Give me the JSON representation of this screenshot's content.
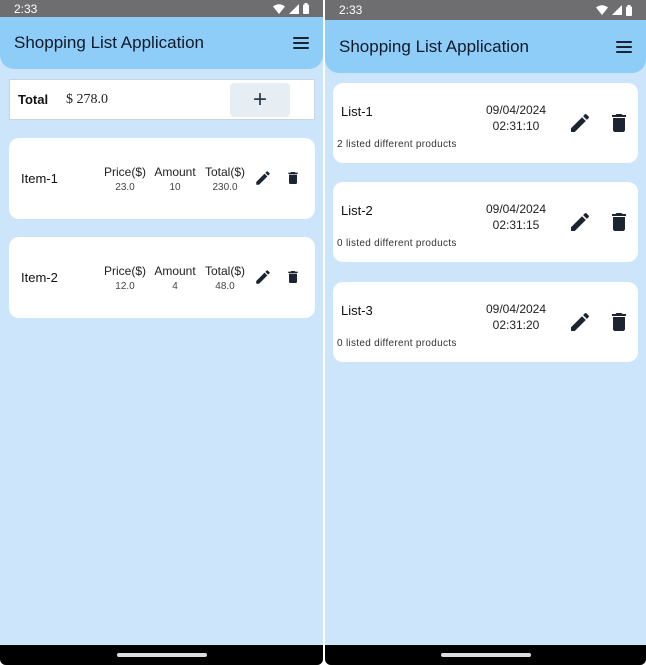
{
  "status_time": "2:33",
  "app_title": "Shopping List Application",
  "icons": {
    "menu": "menu-icon",
    "wifi": "wifi-icon",
    "signal": "signal-icon",
    "battery": "battery-icon",
    "edit": "pencil-icon",
    "delete": "trash-icon",
    "add": "plus-icon"
  },
  "colors": {
    "background": "#cce5fa",
    "appbar": "#8ecdf8",
    "icon": "#1b2430"
  },
  "left_screen": {
    "total_label": "Total",
    "total_value": "$ 278.0",
    "add_label": "+",
    "items": [
      {
        "name": "Item-1",
        "price_label": "Price($)",
        "price": "23.0",
        "amount_label": "Amount",
        "amount": "10",
        "total_label": "Total($)",
        "total": "230.0"
      },
      {
        "name": "Item-2",
        "price_label": "Price($)",
        "price": "12.0",
        "amount_label": "Amount",
        "amount": "4",
        "total_label": "Total($)",
        "total": "48.0"
      }
    ]
  },
  "right_screen": {
    "lists": [
      {
        "name": "List-1",
        "date": "09/04/2024",
        "time": "02:31:10",
        "count": "2 listed different products"
      },
      {
        "name": "List-2",
        "date": "09/04/2024",
        "time": "02:31:15",
        "count": "0 listed different products"
      },
      {
        "name": "List-3",
        "date": "09/04/2024",
        "time": "02:31:20",
        "count": "0 listed different products"
      }
    ]
  }
}
